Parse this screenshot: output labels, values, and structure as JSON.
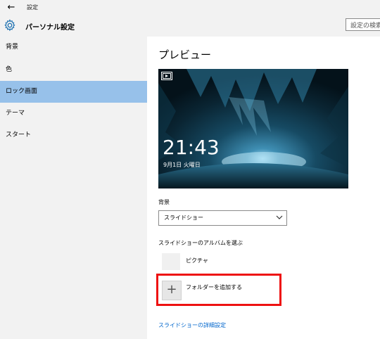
{
  "window": {
    "app_title": "設定",
    "back_glyph": "←"
  },
  "header": {
    "page_title": "パーソナル設定",
    "search_placeholder": "設定の検索",
    "icon": "gear-icon"
  },
  "sidebar": {
    "items": [
      {
        "label": "背景",
        "selected": false
      },
      {
        "label": "色",
        "selected": false
      },
      {
        "label": "ロック画面",
        "selected": true
      },
      {
        "label": "テーマ",
        "selected": false
      },
      {
        "label": "スタート",
        "selected": false
      }
    ]
  },
  "content": {
    "preview_title": "プレビュー",
    "preview_time": "21:43",
    "preview_date": "9月1日 火曜日",
    "background_label": "背景",
    "background_value": "スライドショー",
    "album_section_label": "スライドショーのアルバムを選ぶ",
    "albums": [
      {
        "name": "ピクチャ"
      }
    ],
    "add_folder_glyph": "+",
    "add_folder_label": "フォルダーを追加する",
    "advanced_link": "スライドショーの詳細設定"
  },
  "colors": {
    "selected_nav": "#97c1ea",
    "highlight": "#ee1111",
    "link": "#0066cc",
    "accent_icon": "#1a6fb0"
  }
}
